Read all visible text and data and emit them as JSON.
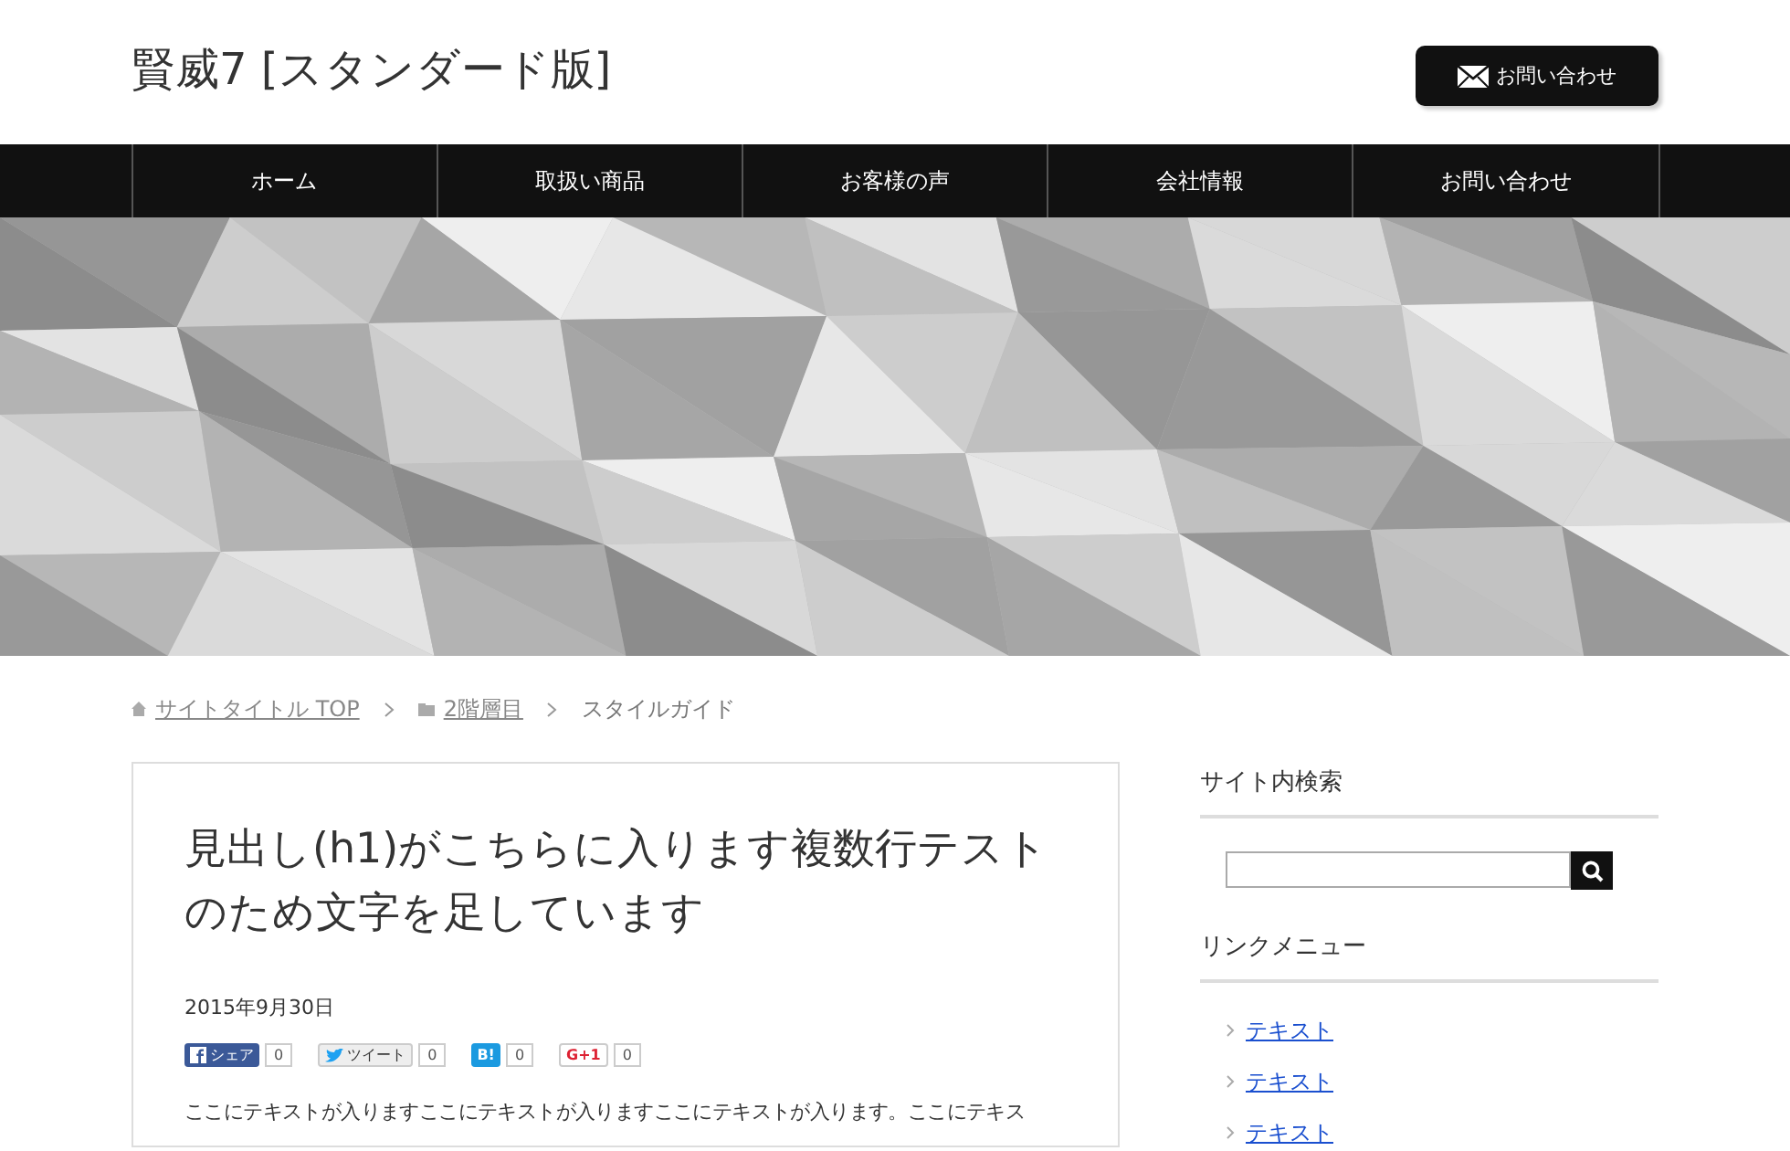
{
  "header": {
    "site_title": "賢威7 [スタンダード版]",
    "contact_button": "お問い合わせ"
  },
  "nav": {
    "items": [
      {
        "label": "ホーム"
      },
      {
        "label": "取扱い商品"
      },
      {
        "label": "お客様の声"
      },
      {
        "label": "会社情報"
      },
      {
        "label": "お問い合わせ"
      }
    ]
  },
  "breadcrumb": [
    {
      "kind": "home",
      "label": "サイトタイトル TOP"
    },
    {
      "kind": "folder",
      "label": "2階層目"
    },
    {
      "kind": "current",
      "label": "スタイルガイド"
    }
  ],
  "article": {
    "title": "見出し(h1)がこちらに入ります複数行テストのため文字を足しています",
    "date": "2015年9月30日",
    "share": [
      {
        "kind": "facebook",
        "label": "シェア",
        "count": "0"
      },
      {
        "kind": "twitter",
        "label": "ツイート",
        "count": "0"
      },
      {
        "kind": "hatena",
        "label": "B!",
        "count": "0"
      },
      {
        "kind": "google",
        "label": "G+1",
        "count": "0"
      }
    ],
    "body": "ここにテキストが入りますここにテキストが入りますここにテキストが入ります。ここにテキス"
  },
  "sidebar": {
    "search_heading": "サイト内検索",
    "link_heading": "リンクメニュー",
    "links": [
      {
        "label": "テキスト"
      },
      {
        "label": "テキスト"
      },
      {
        "label": "テキスト"
      }
    ]
  }
}
